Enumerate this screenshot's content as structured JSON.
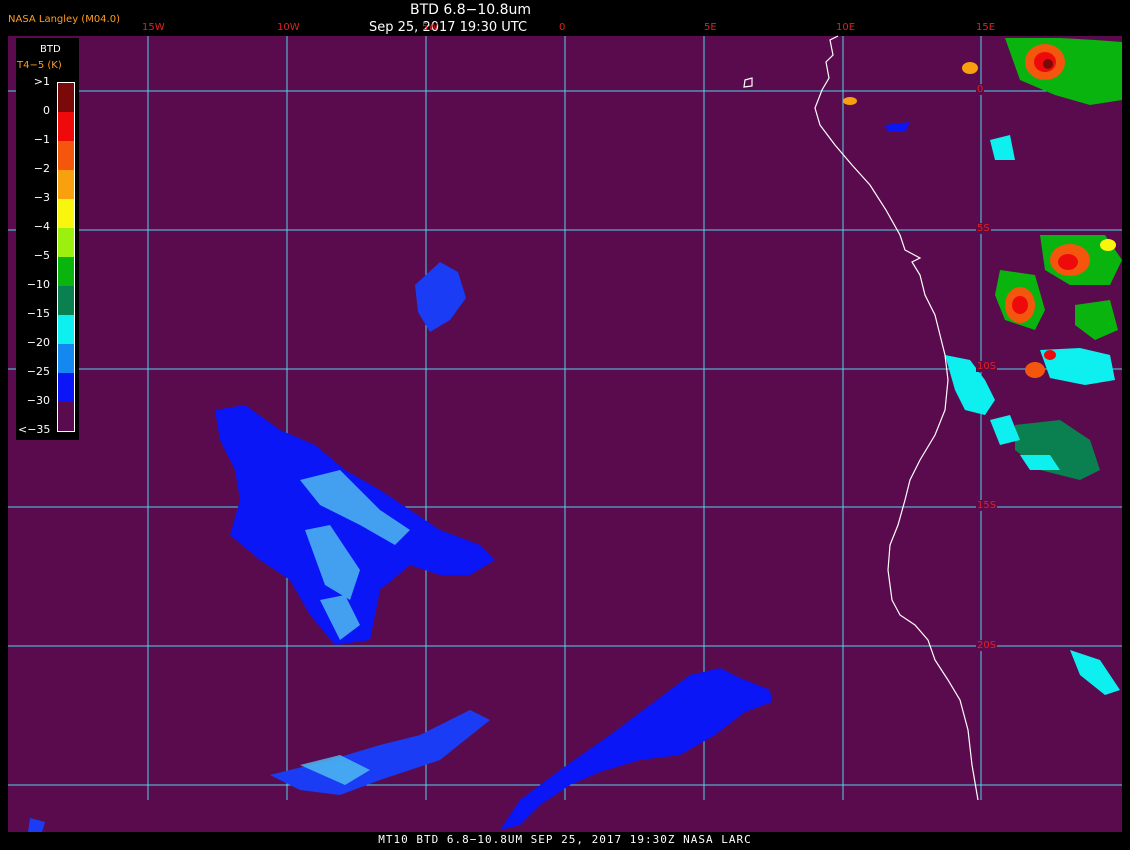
{
  "header": {
    "credit": "NASA Langley (M04.0)",
    "product": "BTD 6.8−10.8um",
    "datetime": "Sep 25, 2017 19:30 UTC"
  },
  "legend": {
    "title": "BTD",
    "units": "T4−5 (K)",
    "ticks": [
      ">1",
      "0",
      "−1",
      "−2",
      "−3",
      "−4",
      "−5",
      "−10",
      "−15",
      "−20",
      "−25",
      "−30",
      "<−35"
    ],
    "colors": [
      "#7a0a0a",
      "#ee0a0a",
      "#f5560e",
      "#f8a00e",
      "#f8f50e",
      "#9cf00e",
      "#0ab40e",
      "#0a8050",
      "#0ef0f0",
      "#1488f0",
      "#0a16f5",
      "#5a0b4d"
    ]
  },
  "longitude_labels": [
    "15W",
    "10W",
    "5W",
    "0",
    "5E",
    "10E",
    "15E"
  ],
  "latitude_labels": [
    "0",
    "5S",
    "10S",
    "15S",
    "20S"
  ],
  "footer": {
    "text": "MT10  BTD 6.8−10.8UM   SEP 25, 2017 19:30Z   NASA LARC"
  },
  "colors": {
    "background": "#5a0b4d",
    "grid": "#4fd4e6",
    "coastline": "#ffffff",
    "label": "#e02020"
  }
}
